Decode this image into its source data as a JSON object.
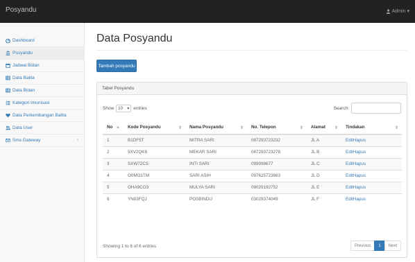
{
  "navbar": {
    "brand": "Posyandu",
    "user": "Admin"
  },
  "sidebar": {
    "items": [
      {
        "label": "Dashboard",
        "icon": "dashboard-icon"
      },
      {
        "label": "Posyandu",
        "icon": "bank-icon"
      },
      {
        "label": "Jadwal Bidan",
        "icon": "calendar-icon"
      },
      {
        "label": "Data Balita",
        "icon": "table-icon"
      },
      {
        "label": "Data Bidan",
        "icon": "table-icon"
      },
      {
        "label": "Kategori Imunisasi",
        "icon": "list-icon"
      },
      {
        "label": "Data Perkembangan Balita",
        "icon": "heart-icon"
      },
      {
        "label": "Data User",
        "icon": "users-icon"
      },
      {
        "label": "Sms Gateway",
        "icon": "envelope-icon"
      }
    ],
    "submenu_glyph": "‹"
  },
  "main": {
    "title": "Data Posyandu",
    "add_button": "Tambah posyandu",
    "panel_title": "Tabel Posyandu",
    "show_label": "Show",
    "page_size": "10",
    "entries_label": "entries",
    "search_label": "Search:",
    "search_value": "",
    "table": {
      "headers": [
        "No",
        "Kode Posyandu",
        "Nama Posyandu",
        "No. Telepon",
        "Alamat",
        "Tindakan"
      ],
      "rows": [
        [
          "1",
          "B1DF5T",
          "MITRA SARI",
          "087293723232",
          "JL A"
        ],
        [
          "2",
          "5XV2QK6",
          "MEKAR SARI",
          "087293723278",
          "JL B"
        ],
        [
          "3",
          "SXW72CS",
          "INTI SARI",
          "099998677",
          "JL C"
        ],
        [
          "4",
          "O0MO1TM",
          "SARI ASIH",
          "097625723663",
          "JL D"
        ],
        [
          "5",
          "OHA9CO3",
          "MULYA SARI",
          "09029192752",
          "JL E"
        ],
        [
          "6",
          "YN03FQJ",
          "POSBINDU",
          "03029374049",
          "JL F"
        ]
      ],
      "edit_label": "Edit",
      "delete_label": "Hapus"
    },
    "info": "Showing 1 to 6 of 6 entries",
    "pagination": {
      "previous": "Previous",
      "current": "1",
      "next": "Next"
    }
  },
  "colors": {
    "navbar": "#222222",
    "primary": "#337ab7",
    "link": "#337ab7"
  }
}
